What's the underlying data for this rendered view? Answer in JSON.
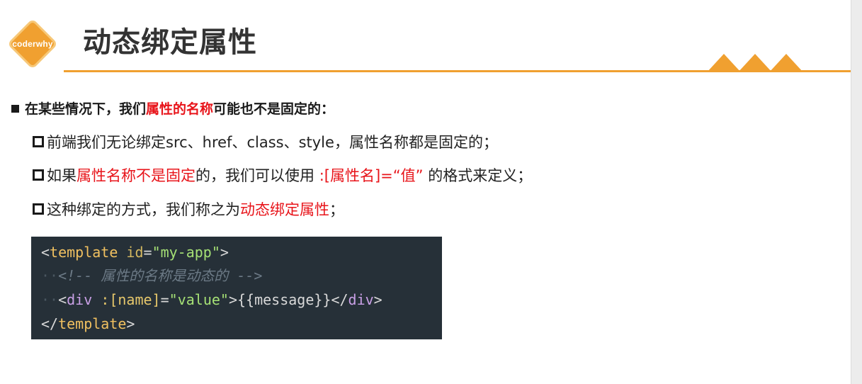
{
  "logo": {
    "text": "coderwhy",
    "color": "#f0a030"
  },
  "title": "动态绑定属性",
  "accent_color": "#f0a030",
  "highlight_color": "#e8141a",
  "main_bullet": {
    "before": "在某些情况下，我们",
    "highlight": "属性的名称",
    "after": "可能也不是固定的："
  },
  "sub_items": [
    {
      "text": "前端我们无论绑定src、href、class、style，属性名称都是固定的；"
    },
    {
      "before": "如果",
      "highlight": "属性名称不是固定",
      "middle": "的，我们可以使用 ",
      "code_highlight": ":[属性名]=“值”",
      "after": " 的格式来定义；"
    },
    {
      "before": "这种绑定的方式，我们称之为",
      "highlight": "动态绑定属性",
      "after": "；"
    }
  ],
  "code": {
    "line1": {
      "open": "<",
      "tag": "template",
      "attr": "id",
      "eq": "=",
      "value": "\"my-app\"",
      "close": ">"
    },
    "line2": {
      "comment": "<!-- 属性的名称是动态的 -->"
    },
    "line3": {
      "open": "<",
      "tag": "div",
      "dyn_attr": ":[name]",
      "eq": "=",
      "value": "\"value\"",
      "gt": ">",
      "content": "{{message}}",
      "close_open": "</",
      "close_tag": "div",
      "close_gt": ">"
    },
    "line4": {
      "open": "</",
      "tag": "template",
      "close": ">"
    }
  }
}
